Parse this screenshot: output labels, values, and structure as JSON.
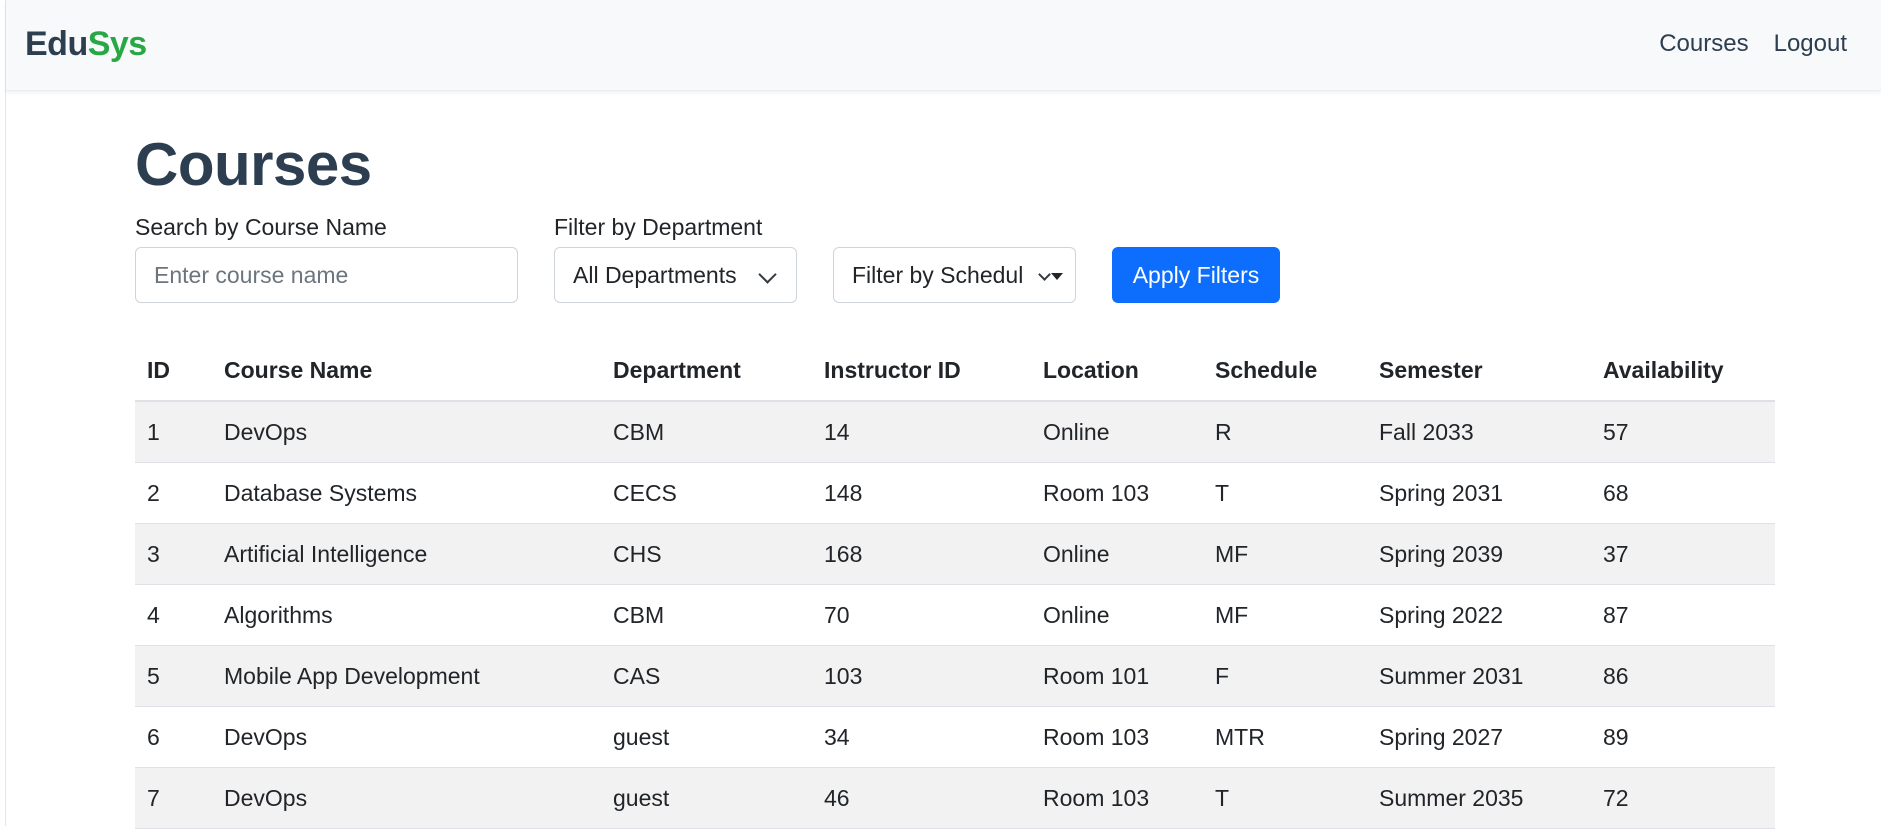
{
  "brand": {
    "part1": "Edu",
    "part2": "Sys"
  },
  "nav": {
    "links": [
      "Courses",
      "Logout"
    ]
  },
  "page": {
    "title": "Courses"
  },
  "filters": {
    "search_label": "Search by Course Name",
    "search_placeholder": "Enter course name",
    "department_label": "Filter by Department",
    "department_value": "All Departments",
    "schedule_value": "Filter by Schedule",
    "apply_label": "Apply Filters"
  },
  "table": {
    "headers": [
      "ID",
      "Course Name",
      "Department",
      "Instructor ID",
      "Location",
      "Schedule",
      "Semester",
      "Availability"
    ],
    "rows": [
      [
        "1",
        "DevOps",
        "CBM",
        "14",
        "Online",
        "R",
        "Fall 2033",
        "57"
      ],
      [
        "2",
        "Database Systems",
        "CECS",
        "148",
        "Room 103",
        "T",
        "Spring 2031",
        "68"
      ],
      [
        "3",
        "Artificial Intelligence",
        "CHS",
        "168",
        "Online",
        "MF",
        "Spring 2039",
        "37"
      ],
      [
        "4",
        "Algorithms",
        "CBM",
        "70",
        "Online",
        "MF",
        "Spring 2022",
        "87"
      ],
      [
        "5",
        "Mobile App Development",
        "CAS",
        "103",
        "Room 101",
        "F",
        "Summer 2031",
        "86"
      ],
      [
        "6",
        "DevOps",
        "guest",
        "34",
        "Room 103",
        "MTR",
        "Spring 2027",
        "89"
      ],
      [
        "7",
        "DevOps",
        "guest",
        "46",
        "Room 103",
        "T",
        "Summer 2035",
        "72"
      ]
    ]
  }
}
